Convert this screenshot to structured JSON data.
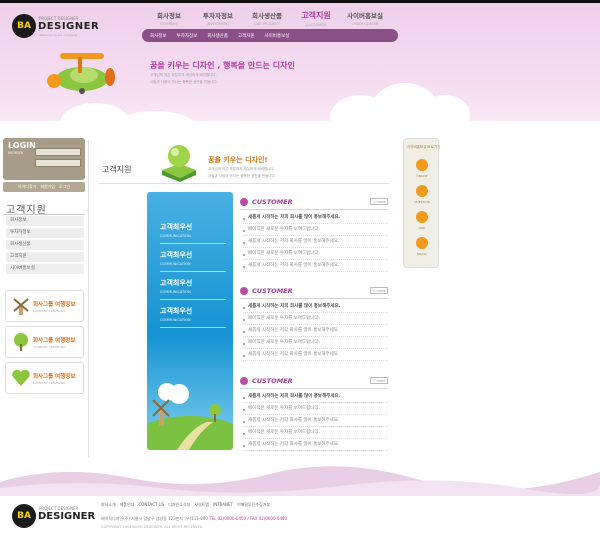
{
  "header": {
    "logo_badge": "BA",
    "logo_small": "PROJECT DESIGNER",
    "logo_word": "DESIGNER",
    "logo_tag": "Welcome to our company",
    "gnb": [
      {
        "ko": "회사정보",
        "en": "COMPANY"
      },
      {
        "ko": "투자자정보",
        "en": "INVESTMENT"
      },
      {
        "ko": "회사생산품",
        "en": "OUR PRODUCT"
      },
      {
        "ko": "고객지원",
        "en": "CUSTOMER"
      },
      {
        "ko": "사이버홍보실",
        "en": "CYBER CENTER"
      }
    ],
    "sub_nav": [
      "회사정보",
      "투자자정보",
      "회사생산품",
      "고객지원",
      "사이버홍보실"
    ]
  },
  "hero": {
    "title": "꿈을 키우는 디자인 , 행복을 만드는 디자인",
    "lines": [
      "고객님의 작은 부분까지 세심하게 배려합니다.",
      "사람과 사람이 만나는 행복한 공간을 만듭니다."
    ]
  },
  "login": {
    "title": "LOGIN",
    "subtitle": "MEMBER",
    "links": [
      "아이디찾기",
      "회원가입",
      "로그인"
    ]
  },
  "lnb": {
    "title": "고객지원",
    "items": [
      "회사정보",
      "투자자정보",
      "회사생산품",
      "고객지원",
      "사이버홍보실"
    ]
  },
  "banners": [
    {
      "title": "회사그룹 여행정보",
      "en": "COMPANY TRAVELING"
    },
    {
      "title": "회사그룹 여행정보",
      "en": "COMPANY TRAVELING"
    },
    {
      "title": "회사그룹 여행정보",
      "en": "COMPANY TRAVELING"
    }
  ],
  "page": {
    "title": "고객지원",
    "intro_title": "꿈을 키우는 디자인!",
    "intro_lines": [
      "고객님의 작은 부분까지 세심하게 배려합니다.",
      "사람과 사람이 만나는 행복한 공간을 만듭니다."
    ]
  },
  "vbanner": [
    {
      "ko": "고객최우선",
      "en": "COMMUNICATION"
    },
    {
      "ko": "고객최우선",
      "en": "COMMUNICATION"
    },
    {
      "ko": "고객최우선",
      "en": "COMMUNICATION"
    },
    {
      "ko": "고객최우선",
      "en": "COMMUNICATION"
    }
  ],
  "sections": [
    {
      "title": "CUSTOMER",
      "more": "+ more",
      "items": [
        "새롭게 시작하는 저희 회사를 많이 홍보해주세요.",
        "베이직한 새로운 투자를 보여드립니다.",
        "새롭게 시작하는 저희 회사를 많이 홍보해주세요.",
        "베이직한 새로운 투자를 보여드립니다.",
        "새롭게 시작하는 저희 회사를 많이 홍보해주세요."
      ]
    },
    {
      "title": "CUSTOMER",
      "more": "+ more",
      "items": [
        "새롭게 시작하는 저희 회사를 많이 홍보해주세요.",
        "베이직한 새로운 투자를 보여드립니다.",
        "새롭게 시작하는 저희 회사를 많이 홍보해주세요.",
        "베이직한 새로운 투자를 보여드립니다.",
        "새롭게 시작하는 저희 회사를 많이 홍보해주세요."
      ]
    },
    {
      "title": "CUSTOMER",
      "more": "+ more",
      "items": [
        "새롭게 시작하는 저희 회사를 많이 홍보해주세요.",
        "베이직한 새로운 투자를 보여드립니다.",
        "새롭게 시작하는 저희 회사를 많이 홍보해주세요.",
        "베이직한 새로운 투자를 보여드립니다.",
        "새롭게 시작하는 저희 회사를 많이 홍보해주세요."
      ]
    }
  ],
  "quick": {
    "title": "사이버홍보실 바로가기",
    "items": [
      {
        "label": "ONLINE",
        "icon": "chat-icon"
      },
      {
        "label": "QUESTION",
        "icon": "megaphone-icon"
      },
      {
        "label": "LINK",
        "icon": "link-icon"
      },
      {
        "label": "MAGIC",
        "icon": "magic-icon"
      }
    ]
  },
  "footer": {
    "links": [
      "회사소개",
      "제품안내",
      "CONTACT US",
      "디자인소식지",
      "사이트맵",
      "INTRANET",
      "이메일무단수집거부"
    ],
    "address": "베이직디자인(주) 서울시 강남구 삼성동 123번지 (우)111-800",
    "tel": "TEL 02)0000-0450 / FAX 02)0000-0480",
    "copyright": "COPYRIGHT 2004 BASIC DESIGNER. ALL RIGHT RESERVED."
  },
  "colors": {
    "accent": "#b23f9e",
    "sub_nav": "#8b4f88",
    "orange": "#e07018",
    "sky": "#1593d2"
  }
}
